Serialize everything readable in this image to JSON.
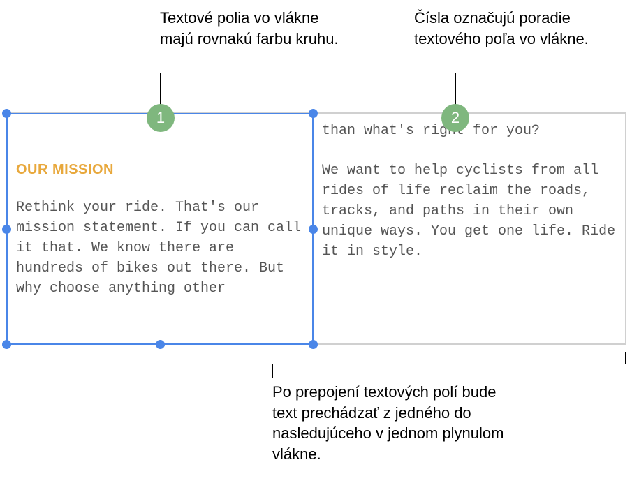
{
  "callouts": {
    "top_left": "Textové polia vo vlákne majú rovnakú farbu kruhu.",
    "top_right": "Čísla označujú poradie textového poľa vo vlákne.",
    "bottom": "Po prepojení textových polí bude text prechádzať z jedného do nasledujúceho v jednom plynulom vlákne."
  },
  "badges": {
    "first": "1",
    "second": "2"
  },
  "textbox1": {
    "heading": "OUR MISSION",
    "body": "Rethink your ride. That's our mission statement. If you can call it that. We know there are hundreds of bikes out there. But why choose anything other"
  },
  "textbox2": {
    "body_top": "than what's right for you?",
    "body_bottom": "We want to help cyclists from all rides of life reclaim the roads, tracks, and paths in their own unique ways. You get one life. Ride it in style."
  }
}
